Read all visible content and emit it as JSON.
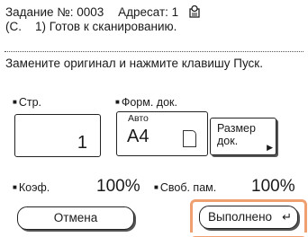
{
  "status": {
    "job": "Задание №: 0003",
    "addressee": "Адресат: 1",
    "queue_icon": "queue-icon",
    "progress_line": "(С.    1) Готов к сканированию."
  },
  "instruction": "Замените оригинал и нажмите клавишу Пуск.",
  "pages": {
    "label": "Стр.",
    "value": "1"
  },
  "doc_format": {
    "label": "Форм. док.",
    "auto": "Авто",
    "size": "A4"
  },
  "doc_size_button": {
    "line1": "Размер",
    "line2": "док."
  },
  "ratio": {
    "label": "Коэф.",
    "value": "100%"
  },
  "free_memory": {
    "label": "Своб. пам.",
    "value": "100%"
  },
  "buttons": {
    "cancel": "Отмена",
    "execute": "Выполнено"
  },
  "colors": {
    "highlight": "#f0a070"
  }
}
